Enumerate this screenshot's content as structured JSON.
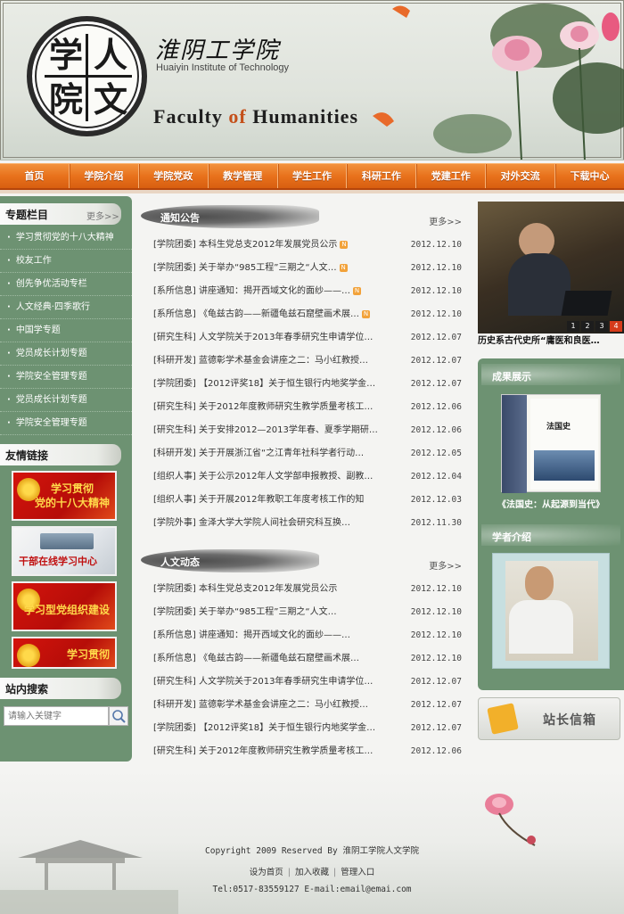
{
  "header": {
    "seal_chars": [
      "学",
      "人",
      "院",
      "文"
    ],
    "school_cn": "淮阴工学院",
    "school_en": "Huaiyin Institute of Technology",
    "faculty_pre": "Faculty ",
    "faculty_of": "of",
    "faculty_post": " Humanities"
  },
  "nav": {
    "items": [
      "首页",
      "学院介绍",
      "学院党政",
      "教学管理",
      "学生工作",
      "科研工作",
      "党建工作",
      "对外交流",
      "下载中心"
    ]
  },
  "left": {
    "special_title": "专题栏目",
    "special_more": "更多>>",
    "special_items": [
      "学习贯彻党的十八大精神",
      "校友工作",
      "创先争优活动专栏",
      "人文经典·四季歌行",
      "中国学专题",
      "党员成长计划专题",
      "学院安全管理专题",
      "党员成长计划专题",
      "学院安全管理专题"
    ],
    "links_title": "友情链接",
    "banners": [
      {
        "text": "学习贯彻\n党的十八大精神"
      },
      {
        "text": "干部在线学习中心"
      },
      {
        "text": "学习型党组织建设"
      },
      {
        "text": "学习贯彻"
      }
    ],
    "search_title": "站内搜索",
    "search_placeholder": "请输入关键字"
  },
  "notice": {
    "title": "通知公告",
    "more": "更多>>",
    "items": [
      {
        "text": "[学院团委] 本科生党总支2012年发展党员公示",
        "new": true,
        "date": "2012.12.10"
      },
      {
        "text": "[学院团委] 关于举办“985工程”三期之“人文…",
        "new": true,
        "date": "2012.12.10"
      },
      {
        "text": "[系所信息] 讲座通知：揭开西域文化的面纱——…",
        "new": true,
        "date": "2012.12.10"
      },
      {
        "text": "[系所信息] 《龟兹古韵——新疆龟兹石窟壁画术展…",
        "new": true,
        "date": "2012.12.10"
      },
      {
        "text": "[研究生科] 人文学院关于2013年春季研究生申请学位…",
        "new": false,
        "date": "2012.12.07"
      },
      {
        "text": "[科研开发] 蓝德彰学术基金会讲座之二：马小红教授…",
        "new": false,
        "date": "2012.12.07"
      },
      {
        "text": "[学院团委] 【2012评奖18】关于恒生银行内地奖学金…",
        "new": false,
        "date": "2012.12.07"
      },
      {
        "text": "[研究生科] 关于2012年度教师研究生教学质量考核工…",
        "new": false,
        "date": "2012.12.06"
      },
      {
        "text": "[研究生科] 关于安排2012—2013学年春、夏季学期研…",
        "new": false,
        "date": "2012.12.06"
      },
      {
        "text": "[科研开发] 关于开展浙江省“之江青年社科学者行动…",
        "new": false,
        "date": "2012.12.05"
      },
      {
        "text": "[组织人事] 关于公示2012年人文学部申报教授、副教…",
        "new": false,
        "date": "2012.12.04"
      },
      {
        "text": "[组织人事] 关于开展2012年教职工年度考核工作的知",
        "new": false,
        "date": "2012.12.03"
      },
      {
        "text": "[学院外事] 金泽大学大学院人间社会研究科互换…",
        "new": false,
        "date": "2012.11.30"
      }
    ]
  },
  "news": {
    "title": "人文动态",
    "more": "更多>>",
    "items": [
      {
        "text": "[学院团委] 本科生党总支2012年发展党员公示",
        "date": "2012.12.10"
      },
      {
        "text": "[学院团委] 关于举办“985工程”三期之“人文…",
        "date": "2012.12.10"
      },
      {
        "text": "[系所信息] 讲座通知：揭开西域文化的面纱——…",
        "date": "2012.12.10"
      },
      {
        "text": "[系所信息] 《龟兹古韵——新疆龟兹石窟壁画术展…",
        "date": "2012.12.10"
      },
      {
        "text": "[研究生科] 人文学院关于2013年春季研究生申请学位…",
        "date": "2012.12.07"
      },
      {
        "text": "[科研开发] 蓝德彰学术基金会讲座之二：马小红教授…",
        "date": "2012.12.07"
      },
      {
        "text": "[学院团委] 【2012评奖18】关于恒生银行内地奖学金…",
        "date": "2012.12.07"
      },
      {
        "text": "[研究生科] 关于2012年度教师研究生教学质量考核工…",
        "date": "2012.12.06"
      }
    ]
  },
  "right": {
    "photo_pages": [
      "1",
      "2",
      "3",
      "4"
    ],
    "photo_caption": "历史系古代史所“庸医和良医…",
    "achievements_title": "成果展示",
    "book_title": "法国史",
    "book_caption": "《法国史：从起源到当代》",
    "scholars_title": "学者介绍",
    "mailbox_label": "站长信箱"
  },
  "footer": {
    "copyright": "Copyright 2009 Reserved By 淮阴工学院人文学院",
    "links": [
      "设为首页",
      "加入收藏",
      "管理入口"
    ],
    "contact": "Tel:0517-83559127 E-mail:email@emai.com"
  },
  "colors": {
    "nav_orange": "#e8721c",
    "sidebar_green": "#6d9272",
    "accent_red": "#d63b1a"
  }
}
